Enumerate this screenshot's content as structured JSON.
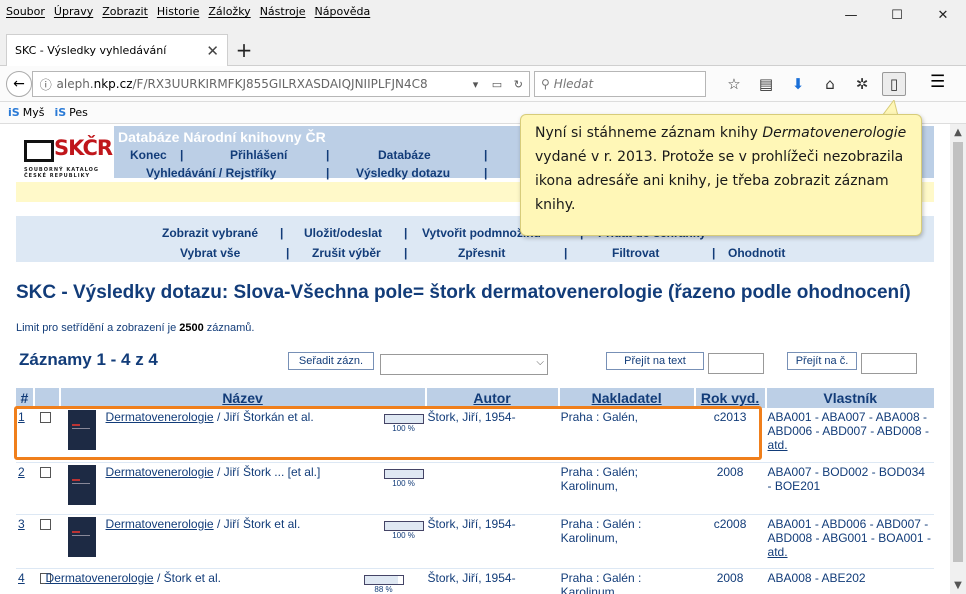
{
  "menu": [
    "Soubor",
    "Úpravy",
    "Zobrazit",
    "Historie",
    "Záložky",
    "Nástroje",
    "Nápověda"
  ],
  "window_controls": {
    "minimize": "—",
    "maximize": "☐",
    "close": "✕"
  },
  "tab": {
    "title": "SKC - Výsledky vyhledávání",
    "close": "✕",
    "new": "+"
  },
  "navbar": {
    "url_prefix": "aleph.",
    "url_domain": "nkp.cz",
    "url_rest": "/F/RX3UURKIRMFKJ855GILRXASDAIQJNIIPLFJN4C8",
    "search_placeholder": "Hledat"
  },
  "bookmarks": [
    {
      "label": "Myš"
    },
    {
      "label": "Pes"
    }
  ],
  "header": {
    "logo_text": "SKČR",
    "logo_sub_1": "SOUBORNÝ KATALOG",
    "logo_sub_2": "ČESKÉ REPUBLIKY",
    "title": "Databáze Národní knihovny ČR",
    "row1": [
      "Konec",
      "Přihlášení",
      "Databáze"
    ],
    "row2": [
      "Vyhledávání / Rejstříky",
      "Výsledky dotazu"
    ]
  },
  "nav": {
    "row1": [
      "Zobrazit vybrané",
      "Uložit/odeslat",
      "Vytvořit podmnožinu",
      "Přidat do schránky"
    ],
    "row2": [
      "Vybrat vše",
      "Zrušit výběr",
      "Zpřesnit",
      "Filtrovat",
      "Ohodnotit"
    ]
  },
  "result_title": "SKC - Výsledky dotazu:  Slova-Všechna pole= štork dermatovenerologie  (řazeno podle ohodnocení)",
  "limit": {
    "text": "Limit pro setřídění a zobrazení je ",
    "value": "2500",
    "suffix": " záznamů."
  },
  "records_label": "Záznamy 1 - 4 z 4",
  "buttons": {
    "sort": "Seřadit zázn.",
    "goto_text": "Přejít na text",
    "goto_num": "Přejít na č."
  },
  "table": {
    "headers": [
      "#",
      "Název",
      "Autor",
      "Nakladatel",
      "Rok vyd.",
      "Vlastník"
    ],
    "rows": [
      {
        "num": "1",
        "title": "Dermatovenerologie",
        "resp": " / Jiří Štorkán et al.",
        "pct": "100 %",
        "pct_value": 100,
        "author": "Štork, Jiří, 1954-",
        "publisher": "Praha : Galén,",
        "year": "c2013",
        "owner": "ABA001 - ABA007 - ABA008 - ABD006 - ABD007 - ABD008 - ",
        "atd": "atd.",
        "cover": true
      },
      {
        "num": "2",
        "title": "Dermatovenerologie",
        "resp": " / Jiří Štork ... [et al.]",
        "pct": "100 %",
        "pct_value": 100,
        "author": "",
        "publisher": "Praha : Galén; Karolinum,",
        "year": "2008",
        "owner": "ABA007 - BOD002 - BOD034 - BOE201",
        "atd": "",
        "cover": true
      },
      {
        "num": "3",
        "title": "Dermatovenerologie",
        "resp": " / Jiří Štork et al.",
        "pct": "100 %",
        "pct_value": 100,
        "author": "Štork, Jiří, 1954-",
        "publisher": "Praha : Galén : Karolinum,",
        "year": "c2008",
        "owner": "ABA001 - ABD006 - ABD007 - ABD008 - ABG001 - BOA001 - ",
        "atd": "atd.",
        "cover": true
      },
      {
        "num": "4",
        "title": "Dermatovenerologie",
        "resp": " / Štork et al.",
        "pct": "88 %",
        "pct_value": 88,
        "author": "Štork, Jiří, 1954-",
        "publisher": "Praha : Galén : Karolinum",
        "year": "2008",
        "owner": "ABA008 - ABE202",
        "atd": "",
        "cover": false
      }
    ]
  },
  "callout": {
    "part1": "Nyní si stáhneme záznam knihy ",
    "italic": "Dermatovenerologie",
    "part2": " vydané v r. 2013. Protože se v prohlížeči nezobrazila ikona adresáře ani knihy, je třeba zobrazit záznam knihy."
  },
  "colors": {
    "accent": "#123c79",
    "highlight": "#f07f1b",
    "callout_bg": "#fff7b7",
    "header_band": "#bccfe6"
  }
}
